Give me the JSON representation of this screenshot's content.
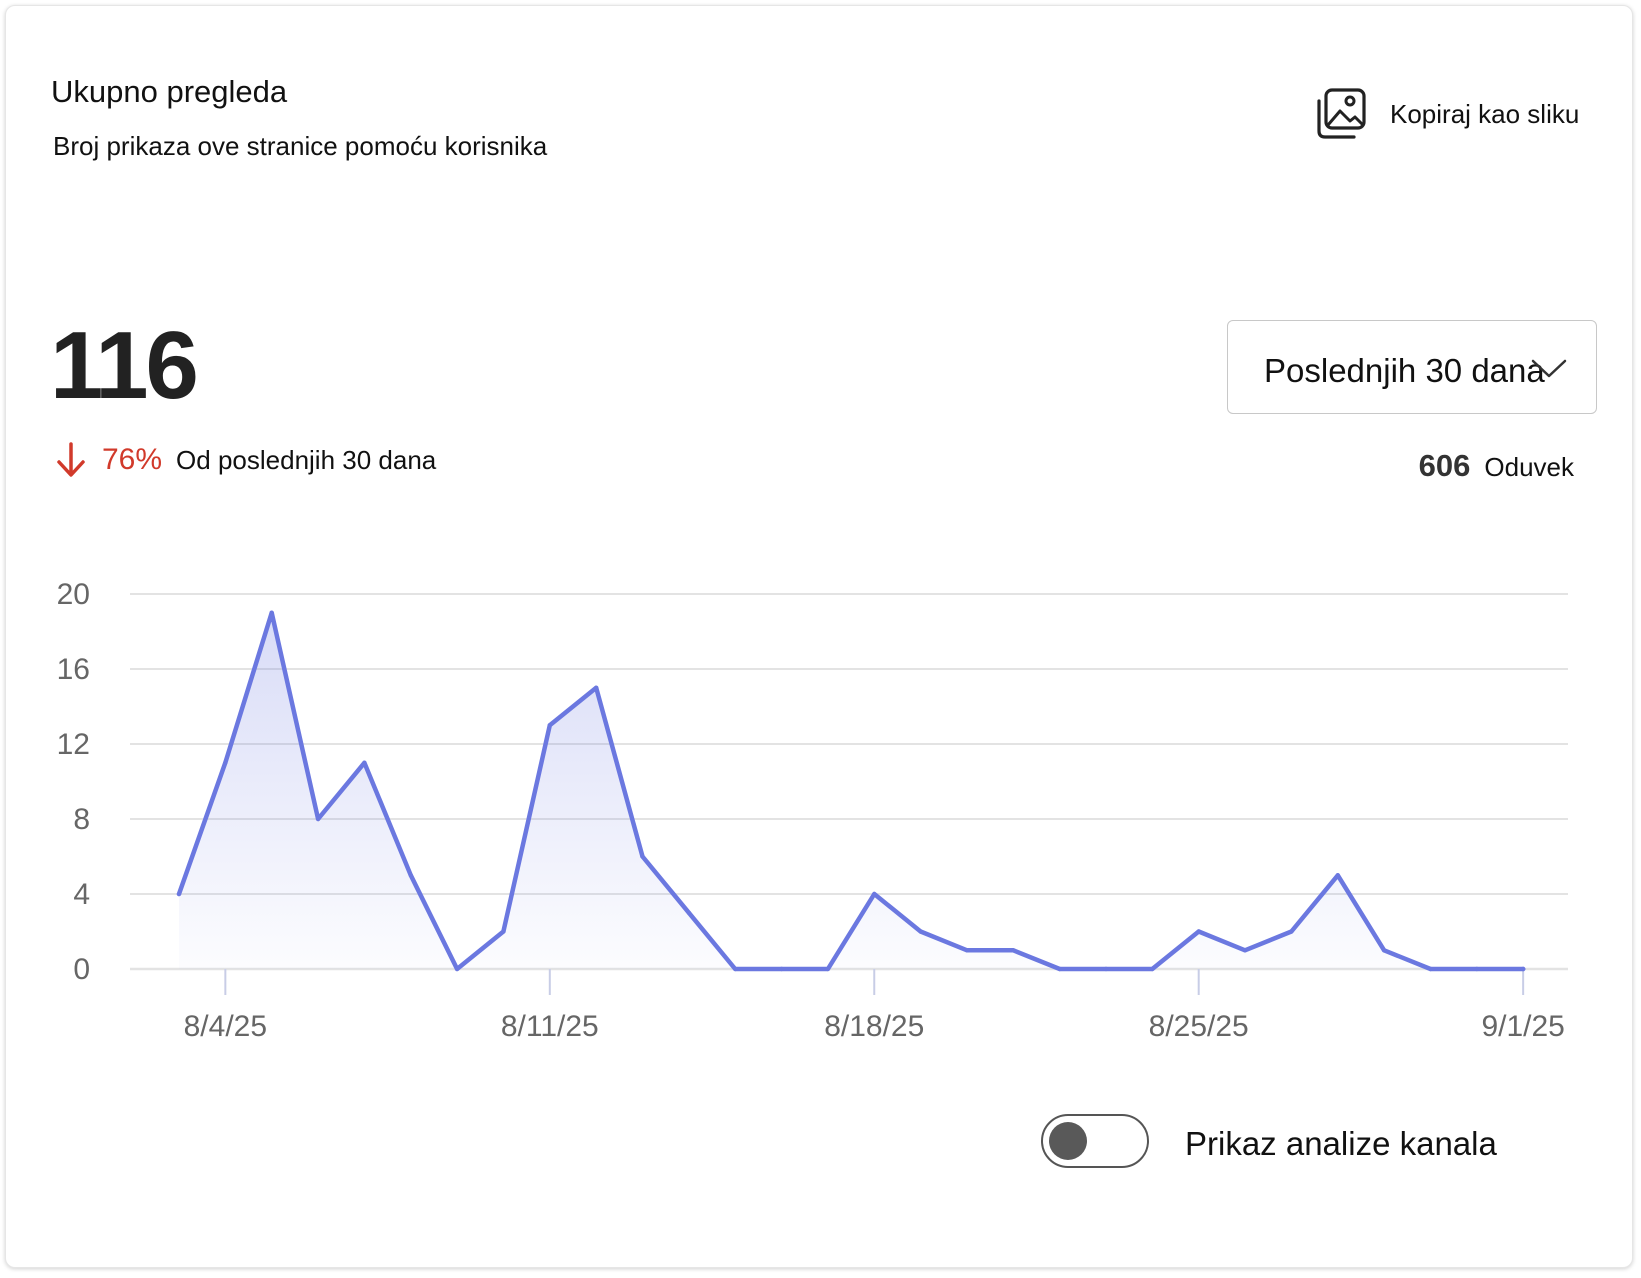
{
  "card": {
    "title": "Ukupno pregleda",
    "subtitle": "Broj prikaza ove stranice pomoću korisnika"
  },
  "actions": {
    "copy_label": "Kopiraj kao sliku",
    "copy_icon": "image-copy-icon"
  },
  "kpi": {
    "value": "116",
    "trend_direction": "down",
    "trend_icon": "arrow-down-icon",
    "trend_percent": "76%",
    "trend_text": "Od poslednjih 30 dana",
    "trend_color": "#d13a2b"
  },
  "range": {
    "selected": "Poslednjih 30 dana",
    "icon": "chevron-down-icon"
  },
  "alltime": {
    "value": "606",
    "label": "Oduvek"
  },
  "toggle": {
    "label": "Prikaz analize kanala",
    "checked": false
  },
  "colors": {
    "line": "#6b78e0",
    "grid": "#e3e3e3",
    "axis_text": "#666666"
  },
  "chart_data": {
    "type": "area",
    "title": "",
    "xlabel": "",
    "ylabel": "",
    "ylim": [
      0,
      20
    ],
    "y_ticks": [
      "0",
      "4",
      "8",
      "12",
      "16",
      "20"
    ],
    "x_tick_labels": [
      "8/4/25",
      "8/11/25",
      "8/18/25",
      "8/25/25",
      "9/1/25"
    ],
    "x_tick_dates": [
      "2025-08-04",
      "2025-08-11",
      "2025-08-18",
      "2025-08-25",
      "2025-09-01"
    ],
    "grid": true,
    "legend": "none",
    "x": [
      "2025-08-03",
      "2025-08-04",
      "2025-08-05",
      "2025-08-06",
      "2025-08-07",
      "2025-08-08",
      "2025-08-09",
      "2025-08-10",
      "2025-08-11",
      "2025-08-12",
      "2025-08-13",
      "2025-08-14",
      "2025-08-15",
      "2025-08-16",
      "2025-08-17",
      "2025-08-18",
      "2025-08-19",
      "2025-08-20",
      "2025-08-21",
      "2025-08-22",
      "2025-08-23",
      "2025-08-24",
      "2025-08-25",
      "2025-08-26",
      "2025-08-27",
      "2025-08-28",
      "2025-08-29",
      "2025-08-30",
      "2025-08-31",
      "2025-09-01"
    ],
    "series": [
      {
        "values": [
          4,
          11,
          19,
          8,
          11,
          5,
          0,
          2,
          13,
          15,
          6,
          3,
          0,
          0,
          0,
          4,
          2,
          1,
          1,
          0,
          0,
          0,
          2,
          1,
          2,
          5,
          1,
          0,
          0,
          0
        ]
      }
    ]
  }
}
